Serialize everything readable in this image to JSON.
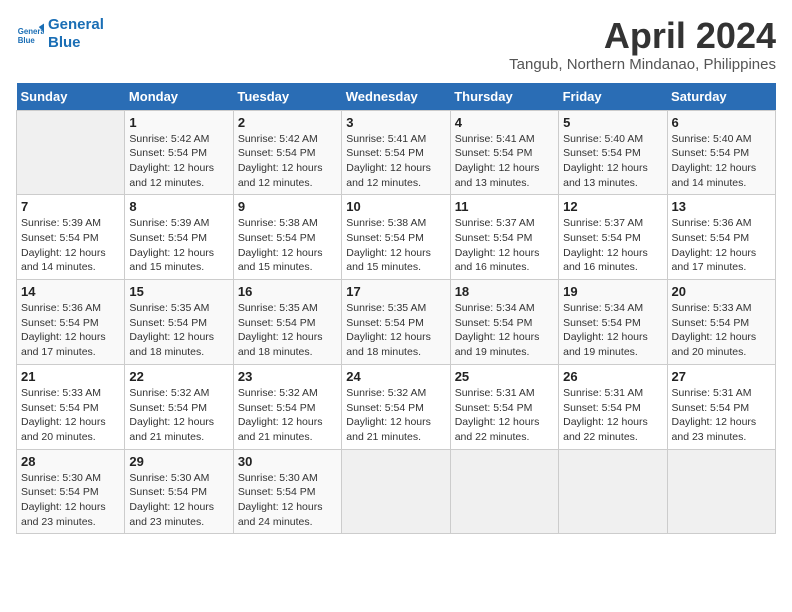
{
  "logo": {
    "line1": "General",
    "line2": "Blue"
  },
  "title": "April 2024",
  "subtitle": "Tangub, Northern Mindanao, Philippines",
  "days_header": [
    "Sunday",
    "Monday",
    "Tuesday",
    "Wednesday",
    "Thursday",
    "Friday",
    "Saturday"
  ],
  "weeks": [
    [
      {
        "day": "",
        "detail": ""
      },
      {
        "day": "1",
        "detail": "Sunrise: 5:42 AM\nSunset: 5:54 PM\nDaylight: 12 hours\nand 12 minutes."
      },
      {
        "day": "2",
        "detail": "Sunrise: 5:42 AM\nSunset: 5:54 PM\nDaylight: 12 hours\nand 12 minutes."
      },
      {
        "day": "3",
        "detail": "Sunrise: 5:41 AM\nSunset: 5:54 PM\nDaylight: 12 hours\nand 12 minutes."
      },
      {
        "day": "4",
        "detail": "Sunrise: 5:41 AM\nSunset: 5:54 PM\nDaylight: 12 hours\nand 13 minutes."
      },
      {
        "day": "5",
        "detail": "Sunrise: 5:40 AM\nSunset: 5:54 PM\nDaylight: 12 hours\nand 13 minutes."
      },
      {
        "day": "6",
        "detail": "Sunrise: 5:40 AM\nSunset: 5:54 PM\nDaylight: 12 hours\nand 14 minutes."
      }
    ],
    [
      {
        "day": "7",
        "detail": "Sunrise: 5:39 AM\nSunset: 5:54 PM\nDaylight: 12 hours\nand 14 minutes."
      },
      {
        "day": "8",
        "detail": "Sunrise: 5:39 AM\nSunset: 5:54 PM\nDaylight: 12 hours\nand 15 minutes."
      },
      {
        "day": "9",
        "detail": "Sunrise: 5:38 AM\nSunset: 5:54 PM\nDaylight: 12 hours\nand 15 minutes."
      },
      {
        "day": "10",
        "detail": "Sunrise: 5:38 AM\nSunset: 5:54 PM\nDaylight: 12 hours\nand 15 minutes."
      },
      {
        "day": "11",
        "detail": "Sunrise: 5:37 AM\nSunset: 5:54 PM\nDaylight: 12 hours\nand 16 minutes."
      },
      {
        "day": "12",
        "detail": "Sunrise: 5:37 AM\nSunset: 5:54 PM\nDaylight: 12 hours\nand 16 minutes."
      },
      {
        "day": "13",
        "detail": "Sunrise: 5:36 AM\nSunset: 5:54 PM\nDaylight: 12 hours\nand 17 minutes."
      }
    ],
    [
      {
        "day": "14",
        "detail": "Sunrise: 5:36 AM\nSunset: 5:54 PM\nDaylight: 12 hours\nand 17 minutes."
      },
      {
        "day": "15",
        "detail": "Sunrise: 5:35 AM\nSunset: 5:54 PM\nDaylight: 12 hours\nand 18 minutes."
      },
      {
        "day": "16",
        "detail": "Sunrise: 5:35 AM\nSunset: 5:54 PM\nDaylight: 12 hours\nand 18 minutes."
      },
      {
        "day": "17",
        "detail": "Sunrise: 5:35 AM\nSunset: 5:54 PM\nDaylight: 12 hours\nand 18 minutes."
      },
      {
        "day": "18",
        "detail": "Sunrise: 5:34 AM\nSunset: 5:54 PM\nDaylight: 12 hours\nand 19 minutes."
      },
      {
        "day": "19",
        "detail": "Sunrise: 5:34 AM\nSunset: 5:54 PM\nDaylight: 12 hours\nand 19 minutes."
      },
      {
        "day": "20",
        "detail": "Sunrise: 5:33 AM\nSunset: 5:54 PM\nDaylight: 12 hours\nand 20 minutes."
      }
    ],
    [
      {
        "day": "21",
        "detail": "Sunrise: 5:33 AM\nSunset: 5:54 PM\nDaylight: 12 hours\nand 20 minutes."
      },
      {
        "day": "22",
        "detail": "Sunrise: 5:32 AM\nSunset: 5:54 PM\nDaylight: 12 hours\nand 21 minutes."
      },
      {
        "day": "23",
        "detail": "Sunrise: 5:32 AM\nSunset: 5:54 PM\nDaylight: 12 hours\nand 21 minutes."
      },
      {
        "day": "24",
        "detail": "Sunrise: 5:32 AM\nSunset: 5:54 PM\nDaylight: 12 hours\nand 21 minutes."
      },
      {
        "day": "25",
        "detail": "Sunrise: 5:31 AM\nSunset: 5:54 PM\nDaylight: 12 hours\nand 22 minutes."
      },
      {
        "day": "26",
        "detail": "Sunrise: 5:31 AM\nSunset: 5:54 PM\nDaylight: 12 hours\nand 22 minutes."
      },
      {
        "day": "27",
        "detail": "Sunrise: 5:31 AM\nSunset: 5:54 PM\nDaylight: 12 hours\nand 23 minutes."
      }
    ],
    [
      {
        "day": "28",
        "detail": "Sunrise: 5:30 AM\nSunset: 5:54 PM\nDaylight: 12 hours\nand 23 minutes."
      },
      {
        "day": "29",
        "detail": "Sunrise: 5:30 AM\nSunset: 5:54 PM\nDaylight: 12 hours\nand 23 minutes."
      },
      {
        "day": "30",
        "detail": "Sunrise: 5:30 AM\nSunset: 5:54 PM\nDaylight: 12 hours\nand 24 minutes."
      },
      {
        "day": "",
        "detail": ""
      },
      {
        "day": "",
        "detail": ""
      },
      {
        "day": "",
        "detail": ""
      },
      {
        "day": "",
        "detail": ""
      }
    ]
  ]
}
